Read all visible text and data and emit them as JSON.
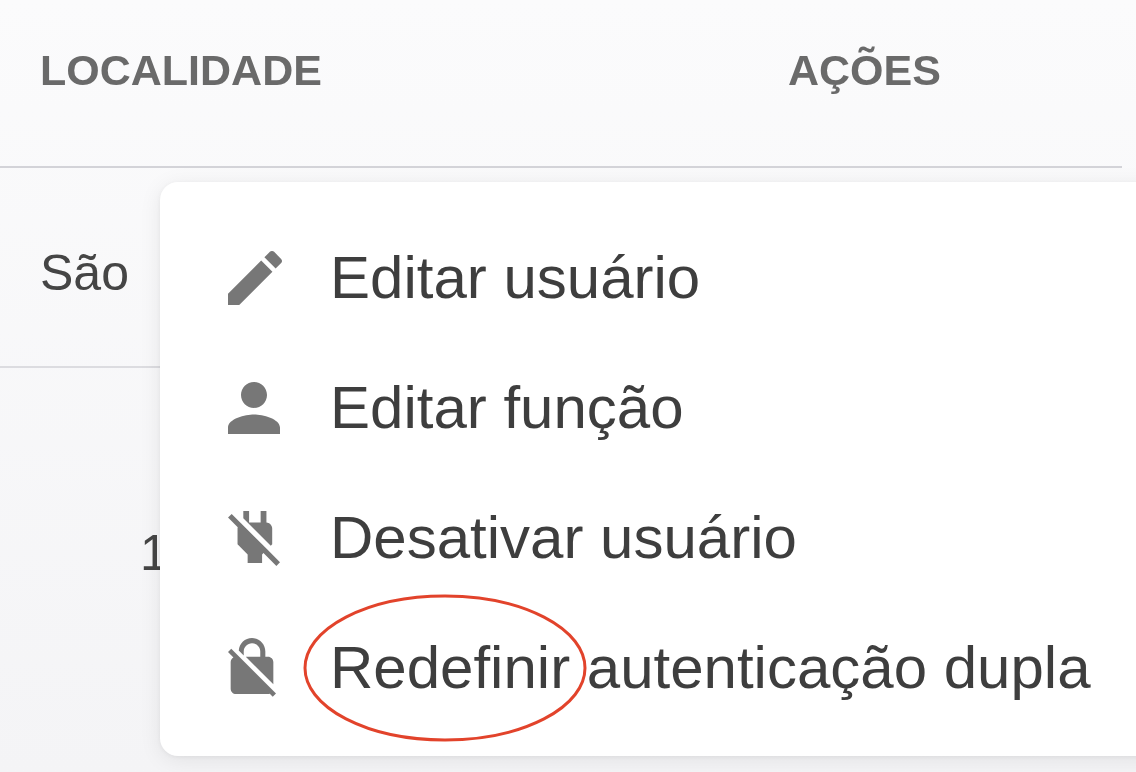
{
  "table": {
    "columns": [
      {
        "label": "LOCALIDADE"
      },
      {
        "label": "AÇÕES"
      }
    ],
    "rows": [
      {
        "cells": [
          "São"
        ]
      },
      {
        "cells": [
          "1"
        ]
      }
    ]
  },
  "menu": {
    "items": [
      {
        "kind": "edit",
        "label": "Editar usuário",
        "circled": false
      },
      {
        "kind": "role",
        "label": "Editar função",
        "circled": false
      },
      {
        "kind": "disable",
        "label": "Desativar usuário",
        "circled": false
      },
      {
        "kind": "reset",
        "label": "Redefinir autenticação dupla",
        "circled": true
      }
    ]
  }
}
